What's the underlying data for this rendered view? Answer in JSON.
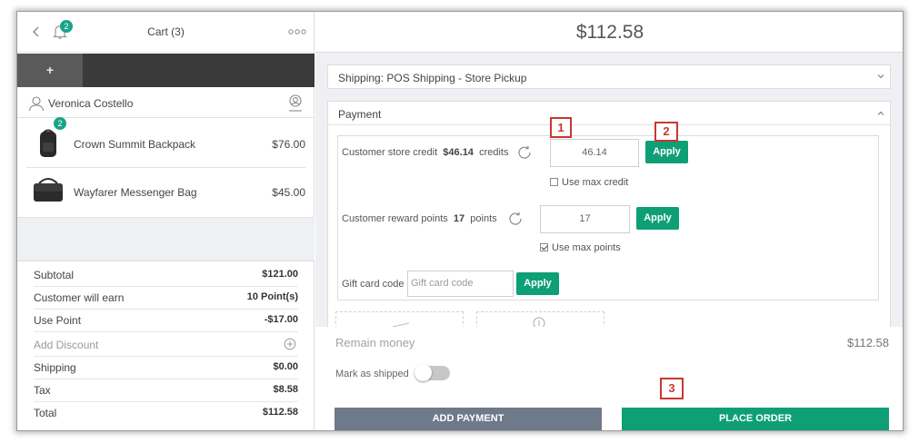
{
  "cart": {
    "title": "Cart (3)",
    "notification_count": "2",
    "add_tab_label": "+",
    "customer_name": "Veronica Costello",
    "items": [
      {
        "name": "Crown Summit Backpack",
        "price": "$76.00",
        "qty_badge": "2"
      },
      {
        "name": "Wayfarer Messenger Bag",
        "price": "$45.00"
      }
    ],
    "totals": {
      "subtotal": {
        "label": "Subtotal",
        "value": "$121.00"
      },
      "earn": {
        "label": "Customer will earn",
        "value": "10 Point(s)"
      },
      "use_point": {
        "label": "Use Point",
        "value": "-$17.00"
      },
      "discount": {
        "label": "Add Discount"
      },
      "shipping": {
        "label": "Shipping",
        "value": "$0.00"
      },
      "tax": {
        "label": "Tax",
        "value": "$8.58"
      },
      "total": {
        "label": "Total",
        "value": "$112.58"
      }
    }
  },
  "checkout": {
    "grand_total": "$112.58",
    "shipping_label": "Shipping: POS Shipping - Store Pickup",
    "payment_label": "Payment",
    "store_credit": {
      "label": "Customer store credit",
      "amount": "$46.14",
      "unit": "credits",
      "input_value": "46.14",
      "apply_label": "Apply",
      "use_max_label": "Use max credit",
      "use_max_checked": false
    },
    "reward_points": {
      "label": "Customer reward points",
      "amount": "17",
      "unit": "points",
      "input_value": "17",
      "apply_label": "Apply",
      "use_max_label": "Use max points",
      "use_max_checked": true
    },
    "gift_card": {
      "label": "Gift card code",
      "placeholder": "Gift card code",
      "apply_label": "Apply"
    },
    "remain_label": "Remain money",
    "remain_value": "$112.58",
    "mark_shipped_label": "Mark as shipped",
    "mark_shipped_on": false,
    "add_payment_label": "ADD PAYMENT",
    "place_order_label": "PLACE ORDER"
  },
  "annotations": [
    "1",
    "2",
    "3"
  ],
  "colors": {
    "accent_green": "#0e9f77",
    "badge_green": "#1aa38a",
    "marker_red": "#c8382e",
    "add_payment_gray": "#6e7a8a"
  }
}
